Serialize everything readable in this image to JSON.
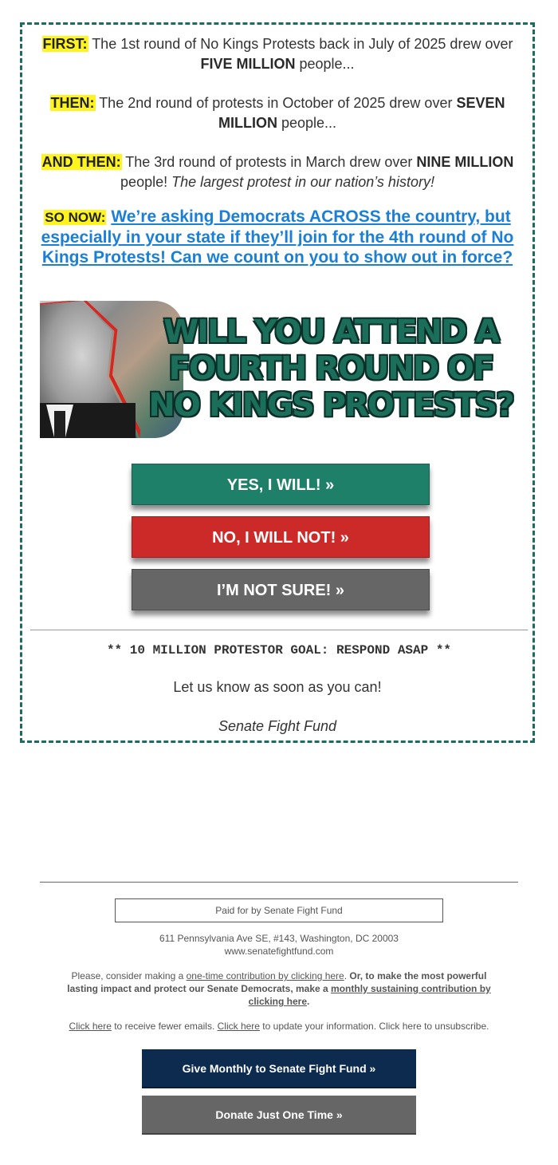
{
  "email": {
    "para1": {
      "label": "FIRST:",
      "text_a": " The 1st round of No Kings Protests back in July of 2025 drew over ",
      "bold": "FIVE MILLION",
      "text_b": " people..."
    },
    "para2": {
      "label": "THEN:",
      "text_a": " The 2nd round of protests in October of 2025 drew over ",
      "bold": "SEVEN MILLION",
      "text_b": " people..."
    },
    "para3": {
      "label": "AND THEN:",
      "text_a": " The 3rd round of protests in March drew over ",
      "bold": "NINE MILLION",
      "text_b": " people! ",
      "italic": "The largest protest in our nation’s history!"
    },
    "cta": {
      "label": "SO NOW:",
      "link": "We’re asking Democrats ACROSS the country, but especially in your state if they’ll join for the 4th round of No Kings Protests! Can we count on you to show out in force?"
    },
    "banner": {
      "headline": "WILL YOU ATTEND A FOURTH ROUND OF NO KINGS PROTESTS?",
      "color": "#1b6e5a"
    },
    "buttons": [
      {
        "label": "YES, I WILL! »",
        "color": "#1e8068"
      },
      {
        "label": "NO, I WILL NOT! »",
        "color": "#cc2a29"
      },
      {
        "label": "I’M NOT SURE! »",
        "color": "#666666"
      }
    ],
    "goal": "** 10 MILLION PROTESTOR GOAL: RESPOND ASAP **",
    "closing": "Let us know as soon as you can!",
    "signature": "Senate Fight Fund",
    "border_color": "#1e6b61"
  },
  "footer": {
    "paid_for": "Paid for by Senate Fight Fund",
    "address": "611 Pennsylvania Ave SE, #143, Washington, DC 20003",
    "website": "www.senatefightfund.com",
    "consider_a": "Please, consider making a ",
    "consider_link": "one-time contribution by clicking here",
    "consider_b": ". ",
    "consider_strong": "Or, to make the most powerful lasting impact and protect our Senate Democrats, make a ",
    "consider_link2": "monthly sustaining contribution by clicking here",
    "consider_end": ".",
    "fewer_link": "Click here",
    "fewer_text": " to receive fewer emails. ",
    "update_link": "Click here",
    "update_text": " to update your information. Click here to unsubscribe.",
    "monthly_button": "Give Monthly to Senate Fight Fund »",
    "monthly_color": "#0d2b4e",
    "onetime_button": "Donate Just One Time »",
    "onetime_color": "#666666"
  }
}
